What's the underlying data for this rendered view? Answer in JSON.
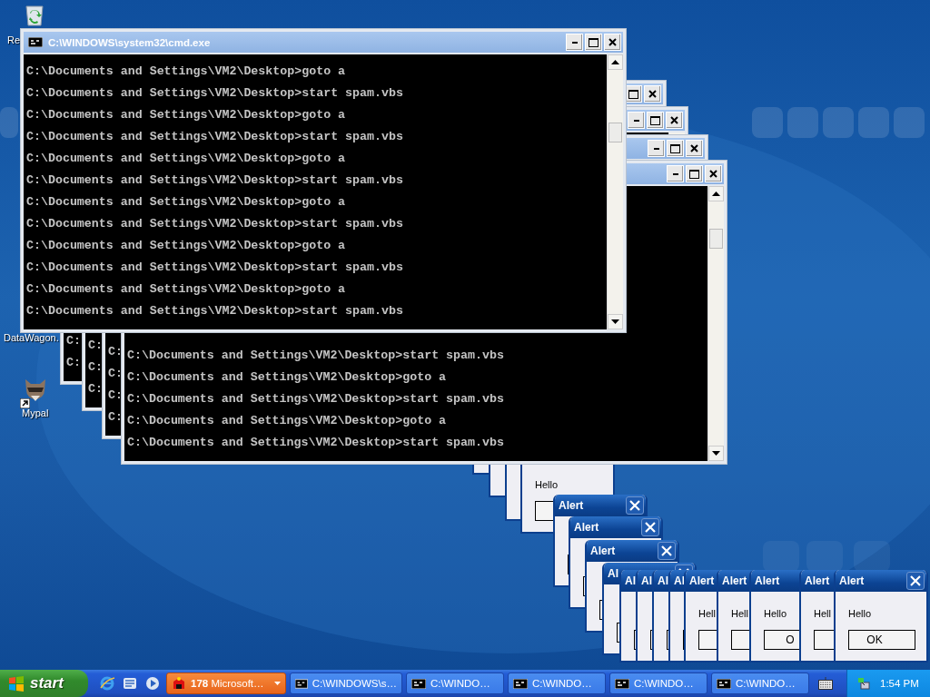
{
  "desktop_icons": [
    {
      "label": "Re",
      "kind": "recycle-bin"
    },
    {
      "label": "DataWagon."
    },
    {
      "label": "Mypal",
      "kind": "animal",
      "shortcut": true
    }
  ],
  "alerts": [
    {
      "kind": "dialog"
    },
    {
      "kind": "dialog"
    },
    {
      "kind": "dialog"
    },
    {
      "kind": "dialog",
      "message": "Hello"
    },
    {
      "kind": "dialog",
      "title": "Alert"
    },
    {
      "kind": "dialog",
      "title": "Alert"
    },
    {
      "kind": "dialog",
      "title": "Alert"
    },
    {
      "kind": "dialog",
      "title": "Al"
    },
    {
      "kind": "dialog",
      "title": "Al"
    },
    {
      "kind": "dialog",
      "title": "Al"
    },
    {
      "kind": "dialog",
      "title": "Al"
    },
    {
      "kind": "dialog",
      "title": "Al"
    },
    {
      "kind": "dialog",
      "title": "Alert",
      "message": "Hell"
    },
    {
      "kind": "dialog",
      "title": "Alert",
      "message": "Hell"
    },
    {
      "kind": "dialog",
      "title": "Alert",
      "message": "Hello",
      "button": "O"
    },
    {
      "kind": "dialog",
      "title": "Alert",
      "message": "Hell"
    },
    {
      "kind": "dialog",
      "title": "Alert",
      "message": "Hello",
      "button": "OK"
    }
  ],
  "console_windows": [
    {
      "title": "C:\\WINDOWS\\system32\\cmd.exe",
      "lines": [
        "C:\\Documents and Settings\\VM2\\Desktop>goto a",
        "C:\\Documents and Settings\\VM2\\Desktop>start spam.vbs",
        "C:\\Documents and Settings\\VM2\\Desktop>goto a",
        "C:\\Documents and Settings\\VM2\\Desktop>start spam.vbs",
        "C:\\Documents and Settings\\VM2\\Desktop>goto a",
        "C:\\Documents and Settings\\VM2\\Desktop>start spam.vbs",
        "C:\\Documents and Settings\\VM2\\Desktop>goto a",
        "C:\\Documents and Settings\\VM2\\Desktop>start spam.vbs",
        "C:\\Documents and Settings\\VM2\\Desktop>goto a",
        "C:\\Documents and Settings\\VM2\\Desktop>start spam.vbs",
        "C:\\Documents and Settings\\VM2\\Desktop>goto a",
        "C:\\Documents and Settings\\VM2\\Desktop>start spam.vbs"
      ]
    },
    {
      "lines": [
        "C:",
        "C:"
      ]
    },
    {
      "lines": [
        "C:",
        "C:",
        "C:"
      ]
    },
    {
      "lines": [
        "C:",
        "C:",
        "C:",
        "C:"
      ]
    },
    {
      "lines": [
        "C:\\Documents and Settings\\VM2\\Desktop>start spam.vbs",
        "C:\\Documents and Settings\\VM2\\Desktop>goto a",
        "C:\\Documents and Settings\\VM2\\Desktop>start spam.vbs",
        "C:\\Documents and Settings\\VM2\\Desktop>goto a",
        "C:\\Documents and Settings\\VM2\\Desktop>start spam.vbs"
      ]
    }
  ],
  "taskbar": {
    "start": "start",
    "quick_launch": [
      {
        "kind": "browser"
      },
      {
        "kind": "mail"
      },
      {
        "kind": "media"
      }
    ],
    "tasks": [
      {
        "label": "**178** Microsoft…",
        "kind": "group",
        "highlighted": true
      },
      {
        "label": "C:\\WINDOWS\\s…",
        "kind": "console",
        "highlighted": false
      },
      {
        "label": "C:\\WINDO…",
        "kind": "console",
        "highlighted": false
      },
      {
        "label": "C:\\WINDO…",
        "kind": "console",
        "highlighted": false
      },
      {
        "label": "C:\\WINDO…",
        "kind": "console",
        "highlighted": false
      },
      {
        "label": "C:\\WINDO…",
        "kind": "console",
        "highlighted": false
      }
    ],
    "clock": "1:54 PM"
  }
}
